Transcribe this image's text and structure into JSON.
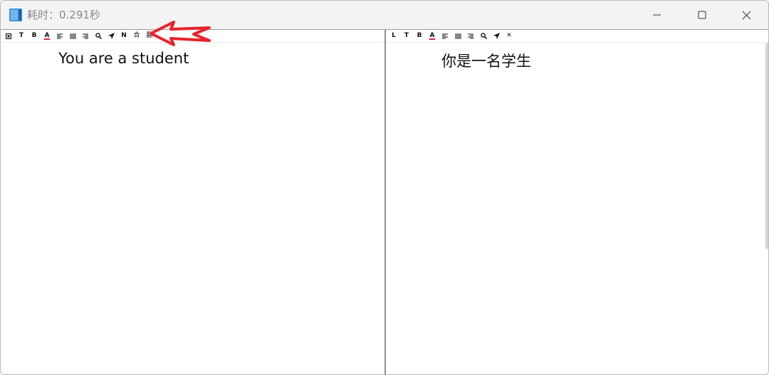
{
  "window": {
    "title": "耗时：0.291秒",
    "icons": [
      "app-icon",
      "minimize-icon",
      "maximize-icon",
      "close-icon"
    ]
  },
  "left_pane": {
    "toolbar": [
      {
        "name": "toggle",
        "label": "◘"
      },
      {
        "name": "text",
        "label": "T"
      },
      {
        "name": "bold",
        "label": "B"
      },
      {
        "name": "font-color",
        "label": "A"
      },
      {
        "name": "align-left",
        "label": "≡"
      },
      {
        "name": "align-justify",
        "label": "≣"
      },
      {
        "name": "align-right",
        "label": "≡"
      },
      {
        "name": "search",
        "label": "🔍"
      },
      {
        "name": "send",
        "label": "➤"
      },
      {
        "name": "new",
        "label": "N"
      },
      {
        "name": "merge",
        "label": "合"
      },
      {
        "name": "translate",
        "label": "翻"
      }
    ],
    "text": "You are a student"
  },
  "right_pane": {
    "toolbar": [
      {
        "name": "lock",
        "label": "L"
      },
      {
        "name": "text",
        "label": "T"
      },
      {
        "name": "bold",
        "label": "B"
      },
      {
        "name": "font-color",
        "label": "A"
      },
      {
        "name": "align-left",
        "label": "≡"
      },
      {
        "name": "align-justify",
        "label": "≣"
      },
      {
        "name": "align-right",
        "label": "≡"
      },
      {
        "name": "search",
        "label": "🔍"
      },
      {
        "name": "send",
        "label": "➤"
      },
      {
        "name": "close",
        "label": "✕"
      }
    ],
    "text": "你是一名学生"
  },
  "colors": {
    "annotation_arrow": "#e8232a",
    "title_text": "#8a8a8a",
    "divider": "#8f8f8f"
  }
}
